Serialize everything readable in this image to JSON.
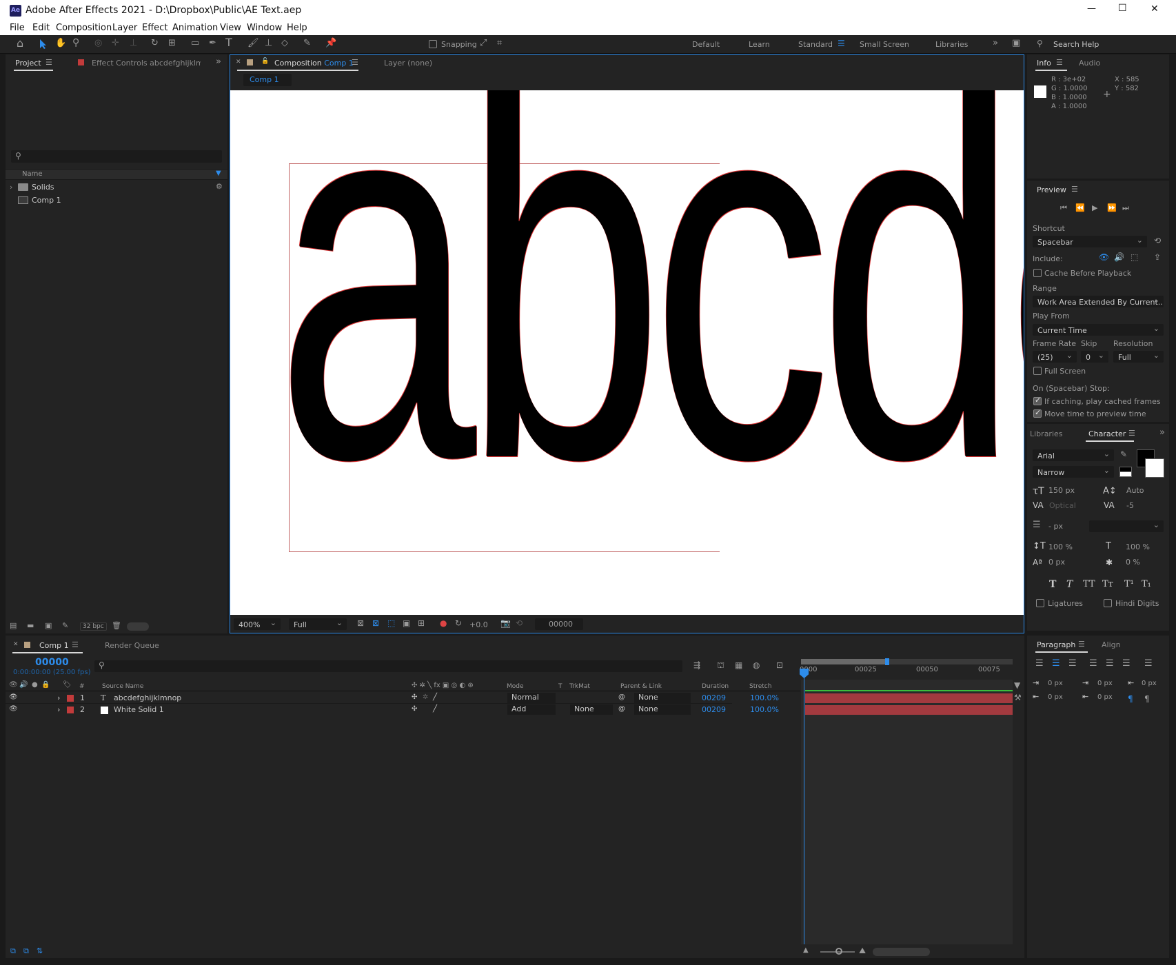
{
  "window": {
    "app_icon": "Ae",
    "title": "Adobe After Effects 2021 - D:\\Dropbox\\Public\\AE Text.aep",
    "minimize": "—",
    "maximize": "☐",
    "close": "✕"
  },
  "menu": [
    "File",
    "Edit",
    "Composition",
    "Layer",
    "Effect",
    "Animation",
    "View",
    "Window",
    "Help"
  ],
  "toolbar": {
    "snapping": "Snapping",
    "workspaces": [
      "Default",
      "Learn",
      "Standard",
      "Small Screen",
      "Libraries"
    ],
    "active_workspace": "Standard",
    "search_placeholder": "Search Help"
  },
  "project": {
    "tab_project": "Project",
    "tab_effect": "Effect Controls abcdefghijklmno",
    "col_name": "Name",
    "items": [
      {
        "name": "Solids",
        "type": "folder"
      },
      {
        "name": "Comp 1",
        "type": "comp"
      }
    ],
    "bpc": "32 bpc"
  },
  "comp": {
    "tab_prefix": "Composition",
    "tab_name": "Comp 1",
    "layer_tab": "Layer (none)",
    "breadcrumb": "Comp 1",
    "canvas_text": "abcde",
    "zoom": "400%",
    "quality": "Full",
    "exposure": "+0.0",
    "timecode": "00000"
  },
  "info": {
    "tab_info": "Info",
    "tab_audio": "Audio",
    "r": "R : 3e+02",
    "g": "G : 1.0000",
    "b": "B : 1.0000",
    "a": "A : 1.0000",
    "x": "X : 585",
    "y": "Y : 582"
  },
  "preview": {
    "title": "Preview",
    "shortcut_label": "Shortcut",
    "shortcut": "Spacebar",
    "include": "Include:",
    "cache": "Cache Before Playback",
    "range_label": "Range",
    "range": "Work Area Extended By Current...",
    "play_from_label": "Play From",
    "play_from": "Current Time",
    "frame_rate_label": "Frame Rate",
    "skip_label": "Skip",
    "resolution_label": "Resolution",
    "frame_rate": "(25)",
    "skip": "0",
    "resolution": "Full",
    "full_screen": "Full Screen",
    "stop_label": "On (Spacebar) Stop:",
    "if_caching": "If caching, play cached frames",
    "move_time": "Move time to preview time"
  },
  "character": {
    "tab_libraries": "Libraries",
    "tab_character": "Character",
    "font": "Arial",
    "style": "Narrow",
    "size": "150 px",
    "leading": "Auto",
    "kerning": "Optical",
    "tracking": "-5",
    "stroke": "- px",
    "vscale": "100 %",
    "hscale": "100 %",
    "baseline": "0 px",
    "tsume": "0 %",
    "styles": [
      "T",
      "T",
      "TT",
      "Tт",
      "T¹",
      "T₁"
    ],
    "ligatures": "Ligatures",
    "hindi": "Hindi Digits"
  },
  "paragraph": {
    "tab_paragraph": "Paragraph",
    "tab_align": "Align",
    "indent_left": "0 px",
    "indent_first": "0 px",
    "indent_right": "0 px",
    "space_before": "0 px",
    "space_after": "0 px"
  },
  "timeline": {
    "tab_comp": "Comp 1",
    "tab_render": "Render Queue",
    "timecode": "00000",
    "timecode_sub": "0:00:00:00 (25.00 fps)",
    "cols": {
      "num": "#",
      "source": "Source Name",
      "mode": "Mode",
      "t": "T",
      "trkmat": "TrkMat",
      "parent": "Parent & Link",
      "duration": "Duration",
      "stretch": "Stretch"
    },
    "layers": [
      {
        "num": "1",
        "name": "abcdefghijklmnop",
        "mode": "Normal",
        "trkmat": "",
        "parent": "None",
        "duration": "00209",
        "stretch": "100.0%",
        "label_color": "#c23b3b",
        "icon": "T"
      },
      {
        "num": "2",
        "name": "White Solid 1",
        "mode": "Add",
        "trkmat": "None",
        "parent": "None",
        "duration": "00209",
        "stretch": "100.0%",
        "label_color": "#c23b3b",
        "icon": "□"
      }
    ],
    "ruler": [
      "0000",
      "00025",
      "00050",
      "00075"
    ]
  }
}
